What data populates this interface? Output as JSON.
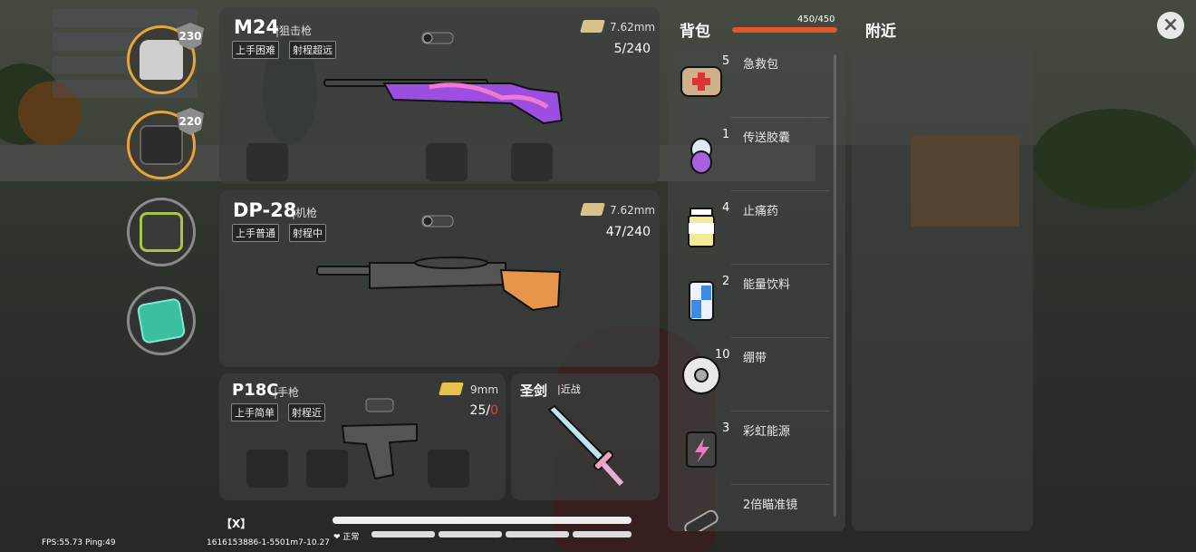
{
  "hud": {
    "fps": "FPS:55.73 Ping:49",
    "coords": "1616153886-1-5501m7-10.27",
    "key_hint": "【X】",
    "status": "正常"
  },
  "equipment": [
    {
      "name": "helmet",
      "durability": "230"
    },
    {
      "name": "vest",
      "durability": "220"
    },
    {
      "name": "backpack"
    },
    {
      "name": "skill-card"
    }
  ],
  "weapons": {
    "m24": {
      "name": "M24",
      "type": "狙击枪",
      "tags": [
        "上手困难",
        "射程超远"
      ],
      "ammo": "7.62mm",
      "count": "5/240"
    },
    "dp28": {
      "name": "DP-28",
      "type": "机枪",
      "tags": [
        "上手普通",
        "射程中"
      ],
      "ammo": "7.62mm",
      "count": "47/240"
    },
    "p18c": {
      "name": "P18C",
      "type": "手枪",
      "tags": [
        "上手简单",
        "射程近"
      ],
      "ammo": "9mm",
      "count_loaded": "25",
      "count_reserve": "0"
    },
    "sword": {
      "name": "圣剑",
      "type": "近战"
    }
  },
  "backpack": {
    "title": "背包",
    "capacity": "450/450",
    "capacity_fraction": 1.0,
    "items": [
      {
        "qty": "5",
        "name": "急救包",
        "icon": "first-aid-kit-icon"
      },
      {
        "qty": "1",
        "name": "传送胶囊",
        "icon": "teleport-capsule-icon"
      },
      {
        "qty": "4",
        "name": "止痛药",
        "icon": "painkiller-icon"
      },
      {
        "qty": "2",
        "name": "能量饮料",
        "icon": "energy-drink-icon"
      },
      {
        "qty": "10",
        "name": "绷带",
        "icon": "bandage-icon"
      },
      {
        "qty": "3",
        "name": "彩虹能源",
        "icon": "rainbow-fuel-icon"
      },
      {
        "qty": "",
        "name": "2倍瞄准镜",
        "icon": "scope-2x-icon"
      }
    ]
  },
  "nearby": {
    "title": "附近"
  },
  "close_label": "×"
}
